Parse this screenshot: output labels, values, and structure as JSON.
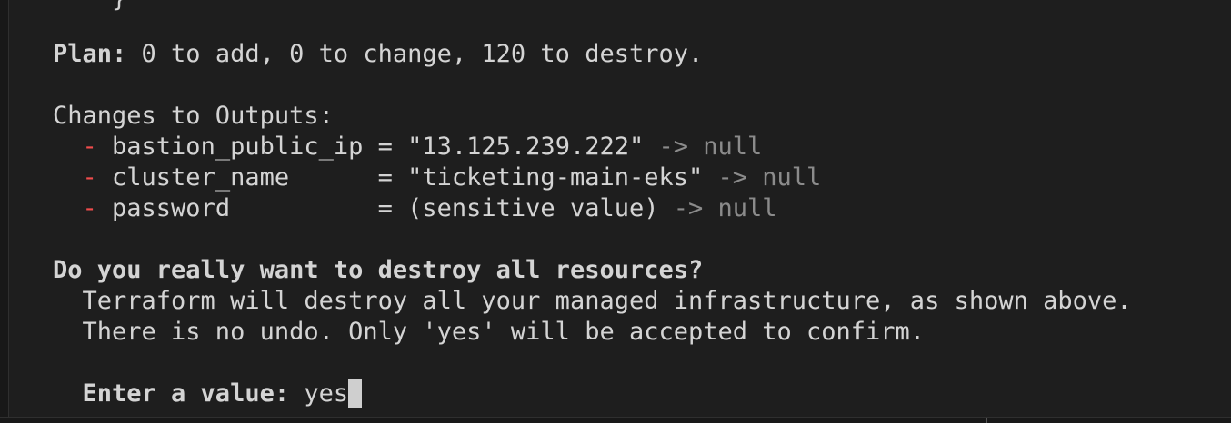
{
  "top_fragment": "    }",
  "plan": {
    "label": "Plan:",
    "text": " 0 to add, 0 to change, 120 to destroy."
  },
  "outputs": {
    "header": "Changes to Outputs:",
    "items": [
      {
        "marker": "  - ",
        "text": "bastion_public_ip = \"13.125.239.222\"",
        "arrow": " -> null"
      },
      {
        "marker": "  - ",
        "text": "cluster_name      = \"ticketing-main-eks\"",
        "arrow": " -> null"
      },
      {
        "marker": "  - ",
        "text": "password          = (sensitive value)",
        "arrow": " -> null"
      }
    ]
  },
  "prompt": {
    "question": "Do you really want to destroy all resources?",
    "description_1": "  Terraform will destroy all your managed infrastructure, as shown above.",
    "description_2": "  There is no undo. Only 'yes' will be accepted to confirm.",
    "input_label": "  Enter a value:",
    "input_value": " yes"
  },
  "colors": {
    "background": "#1e1e1e",
    "text": "#d4d4d4",
    "minus": "#f14c4c",
    "null": "#8b8b8b"
  }
}
